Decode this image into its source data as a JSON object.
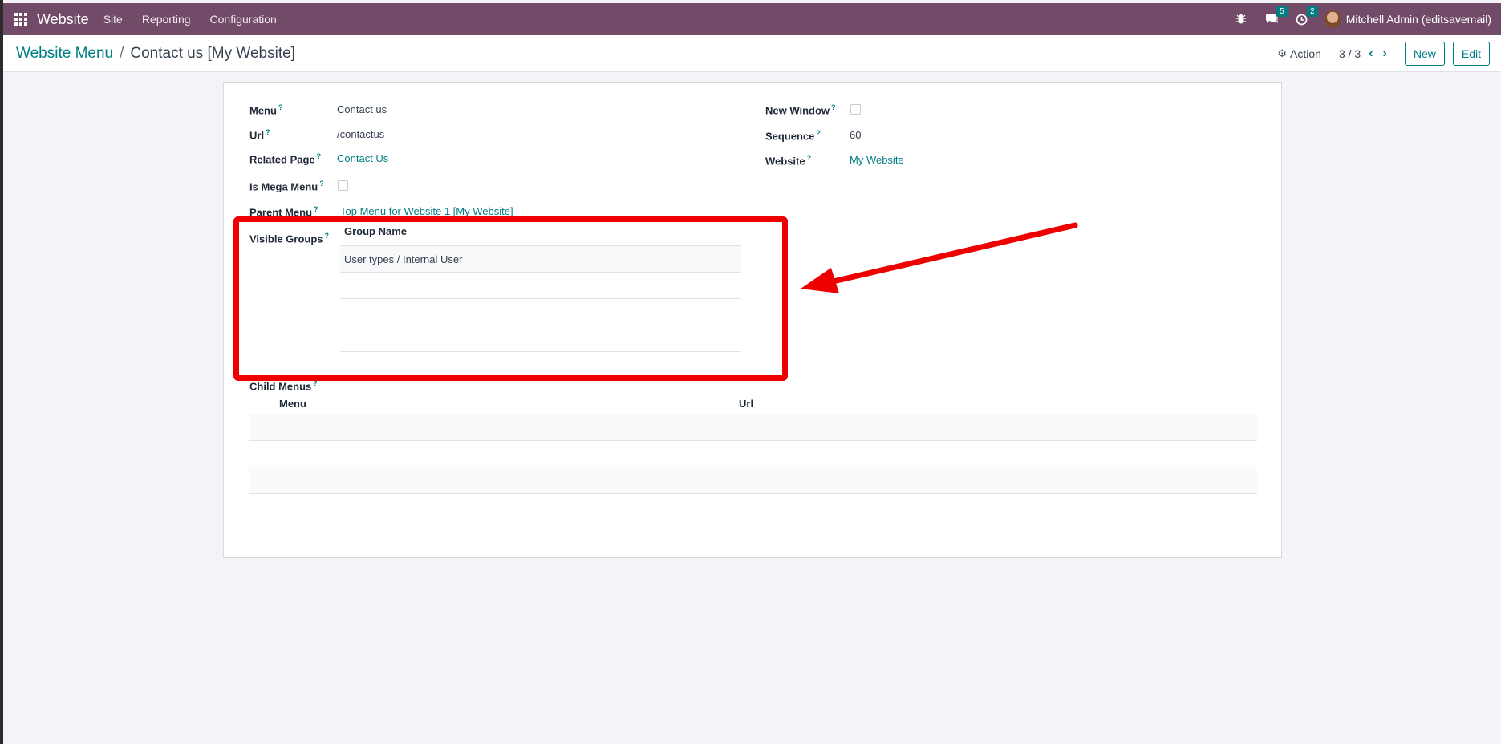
{
  "navbar": {
    "brand": "Website",
    "menu": [
      "Site",
      "Reporting",
      "Configuration"
    ],
    "messages_count": "5",
    "activities_count": "2",
    "user": "Mitchell Admin (editsavemail)"
  },
  "control_panel": {
    "breadcrumb_parent": "Website Menu",
    "breadcrumb_separator": "/",
    "breadcrumb_current": "Contact us [My Website]",
    "action_label": "Action",
    "pager": "3 / 3",
    "new_label": "New",
    "edit_label": "Edit"
  },
  "form": {
    "help_mark": "?",
    "menu_label": "Menu",
    "menu_value": "Contact us",
    "url_label": "Url",
    "url_value": "/contactus",
    "related_page_label": "Related Page",
    "related_page_value": "Contact Us",
    "is_mega_menu_label": "Is Mega Menu",
    "is_mega_menu_checked": false,
    "parent_menu_label": "Parent Menu",
    "parent_menu_value": "Top Menu for Website 1 [My Website]",
    "visible_groups_label": "Visible Groups",
    "new_window_label": "New Window",
    "new_window_checked": false,
    "sequence_label": "Sequence",
    "sequence_value": "60",
    "website_label": "Website",
    "website_value": "My Website"
  },
  "groups_table": {
    "header": "Group Name",
    "rows": [
      "User types / Internal User",
      "",
      "",
      ""
    ]
  },
  "child_menus": {
    "label": "Child Menus",
    "columns": [
      "Menu",
      "Url"
    ],
    "rows": [
      [
        "",
        ""
      ],
      [
        "",
        ""
      ],
      [
        "",
        ""
      ],
      [
        "",
        ""
      ]
    ]
  },
  "annotation": {
    "highlight_color": "#ee0000"
  }
}
